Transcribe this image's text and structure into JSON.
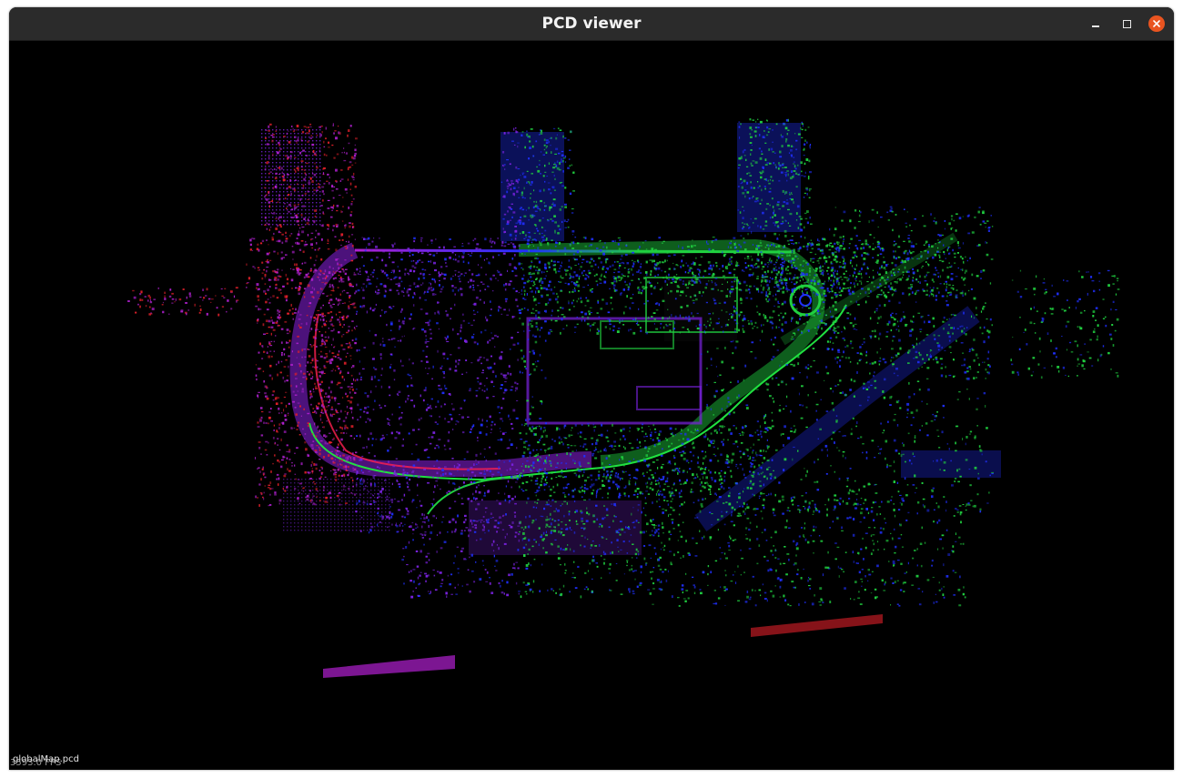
{
  "window": {
    "title": "PCD viewer"
  },
  "viewport": {
    "cloud_label": "globalMap.pcd",
    "fps_label": "3593.0 FPS"
  },
  "colors": {
    "background": "#000000",
    "titlebar": "#2b2b2b",
    "close_button": "#e95420",
    "cloud_red": "#e0202a",
    "cloud_magenta": "#b020d0",
    "cloud_purple": "#7a22e0",
    "cloud_blue": "#2030ff",
    "cloud_green": "#20d040"
  },
  "icons": [
    "minimize-icon",
    "maximize-icon",
    "close-icon"
  ]
}
